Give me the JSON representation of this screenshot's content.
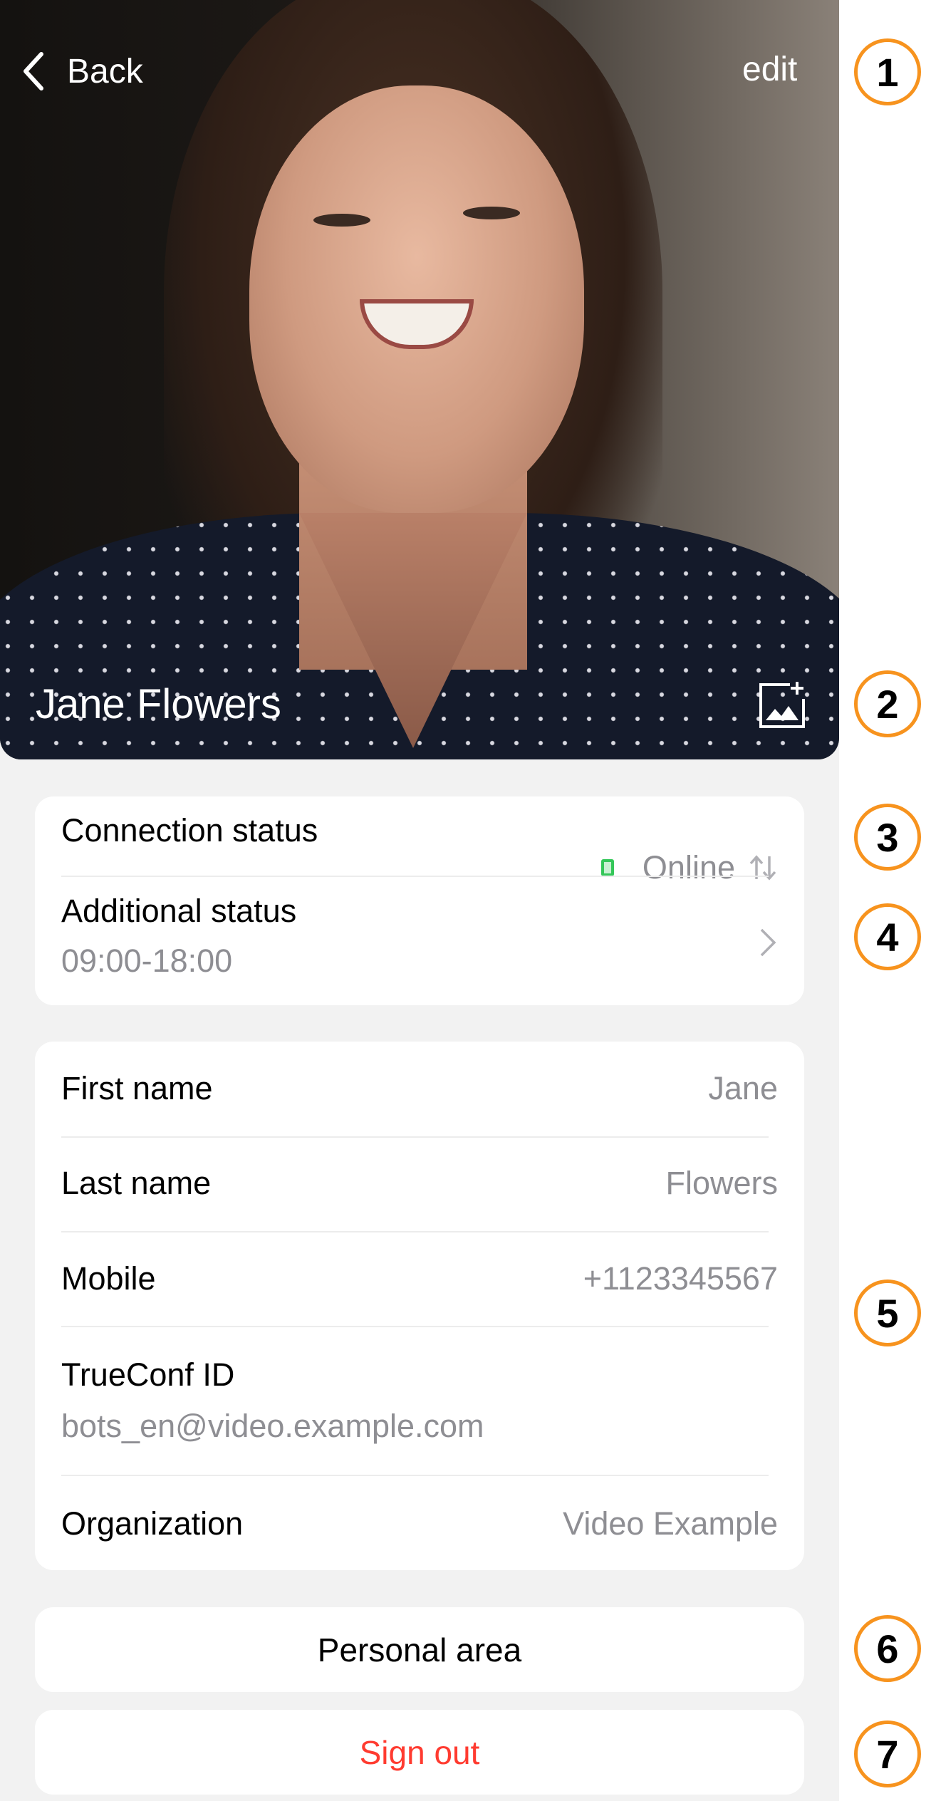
{
  "header": {
    "back_label": "Back",
    "edit_label": "edit"
  },
  "profile": {
    "name": "Jane Flowers",
    "change_photo_icon": "image-plus-icon"
  },
  "status_card": {
    "connection_label": "Connection status",
    "connection_value": "Online",
    "connection_color": "#34c759",
    "additional_label": "Additional status",
    "additional_value": "09:00-18:00"
  },
  "info_card": {
    "rows": [
      {
        "label": "First name",
        "value": "Jane"
      },
      {
        "label": "Last name",
        "value": "Flowers"
      },
      {
        "label": "Mobile",
        "value": "+1123345567"
      },
      {
        "label": "TrueConf ID",
        "value": "bots_en@video.example.com"
      },
      {
        "label": "Organization",
        "value": "Video Example"
      }
    ]
  },
  "actions": {
    "personal_area": "Personal area",
    "sign_out": "Sign out",
    "sign_out_color": "#ff3b30"
  },
  "callouts": [
    "1",
    "2",
    "3",
    "4",
    "5",
    "6",
    "7"
  ],
  "callout_color": "#f7931e"
}
